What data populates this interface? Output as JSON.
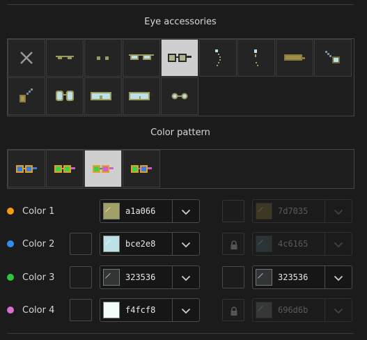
{
  "accessories": {
    "title": "Eye accessories",
    "items": [
      {
        "name": "none",
        "icon": "none-x-icon"
      },
      {
        "name": "thin-sunglasses",
        "icon": "thin-sunglasses-icon"
      },
      {
        "name": "dot-eyes",
        "icon": "dot-eyes-icon"
      },
      {
        "name": "aviators",
        "icon": "aviator-glasses-icon"
      },
      {
        "name": "square-glasses",
        "icon": "square-glasses-icon",
        "selected": true
      },
      {
        "name": "dangling-earring",
        "icon": "dangling-earring-icon"
      },
      {
        "name": "stud-earring",
        "icon": "stud-earring-icon"
      },
      {
        "name": "eye-mask",
        "icon": "eye-mask-icon"
      },
      {
        "name": "monocle-right",
        "icon": "monocle-right-icon"
      },
      {
        "name": "monocle-left",
        "icon": "monocle-left-icon"
      },
      {
        "name": "round-glasses",
        "icon": "round-glasses-icon"
      },
      {
        "name": "goggles",
        "icon": "goggles-icon"
      },
      {
        "name": "wide-goggles",
        "icon": "wide-goggles-icon"
      },
      {
        "name": "small-round-glasses",
        "icon": "small-round-glasses-icon"
      }
    ]
  },
  "pattern": {
    "title": "Color pattern",
    "items": [
      {
        "name": "pattern-1",
        "icon": "pattern-1-icon"
      },
      {
        "name": "pattern-2",
        "icon": "pattern-2-icon"
      },
      {
        "name": "pattern-3",
        "icon": "pattern-3-icon",
        "selected": true
      },
      {
        "name": "pattern-4",
        "icon": "pattern-4-icon"
      }
    ]
  },
  "colors": [
    {
      "label": "Color 1",
      "dot": "#f39c12",
      "hex": "a1a066",
      "swatch": "#a1a066",
      "right_hex": "7d7035",
      "right_swatch": "#7d7035",
      "has_left_box": false,
      "right_enabled": false,
      "right_box_lock": false
    },
    {
      "label": "Color 2",
      "dot": "#2d8ff0",
      "hex": "bce2e8",
      "swatch": "#bce2e8",
      "right_hex": "4c6165",
      "right_swatch": "#4c6165",
      "has_left_box": true,
      "right_enabled": false,
      "right_box_lock": true
    },
    {
      "label": "Color 3",
      "dot": "#2ec43f",
      "hex": "323536",
      "swatch": "#323536",
      "right_hex": "323536",
      "right_swatch": "#323536",
      "has_left_box": true,
      "right_enabled": true,
      "right_box_lock": false
    },
    {
      "label": "Color 4",
      "dot": "#d86fd0",
      "hex": "f4fcf8",
      "swatch": "#f4fcf8",
      "right_hex": "696d6b",
      "right_swatch": "#696d6b",
      "has_left_box": true,
      "right_enabled": false,
      "right_box_lock": true
    }
  ]
}
